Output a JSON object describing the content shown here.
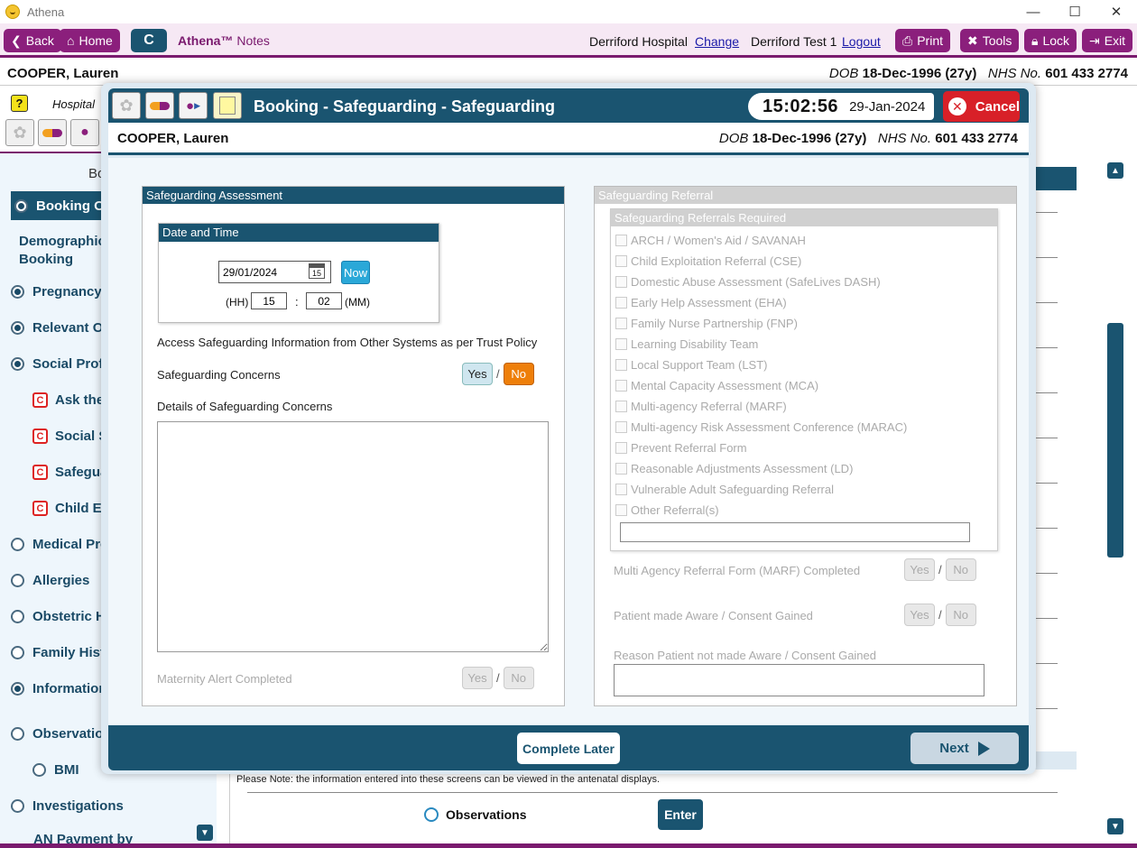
{
  "window": {
    "title": "Athena",
    "minimize": "—",
    "maximize": "☐",
    "close": "✕"
  },
  "toolbar": {
    "back_label": "Back",
    "home_label": "Home",
    "c_label": "C",
    "brand_name": "Athena™",
    "brand_suffix": "Notes",
    "hospital": "Derriford Hospital",
    "change_label": "Change",
    "user": "Derriford Test 1",
    "logout_label": "Logout",
    "print_label": "Print",
    "tools_label": "Tools",
    "lock_label": "Lock",
    "exit_label": "Exit",
    "accent": "#8b1f7c"
  },
  "patient": {
    "name": "COOPER, Lauren",
    "dob_label": "DOB",
    "dob": "18-Dec-1996 (27y)",
    "nhs_label": "NHS No.",
    "nhs": "601 433 2774"
  },
  "background": {
    "help_icon": "?",
    "hospital_label": "Hospital",
    "booking_title": "Bo",
    "nav_items": [
      {
        "label": "Booking Ov",
        "radio": "on",
        "active": true
      },
      {
        "label": "Demographics",
        "label2": "Booking"
      },
      {
        "label": "Pregnancy",
        "radio": "on"
      },
      {
        "label": "Relevant Ot",
        "radio": "on"
      },
      {
        "label": "Social Profil",
        "radio": "on"
      },
      {
        "label": "Ask the",
        "badge": "C"
      },
      {
        "label": "Social Se",
        "badge": "C"
      },
      {
        "label": "Safegua",
        "badge": "C"
      },
      {
        "label": "Child Exp",
        "badge": "C"
      },
      {
        "label": "Medical Pro",
        "radio": "off"
      },
      {
        "label": "Allergies",
        "radio": "off"
      },
      {
        "label": "Obstetric H",
        "radio": "off"
      },
      {
        "label": "Family Histo",
        "radio": "off"
      },
      {
        "label": "Information",
        "radio": "on"
      },
      {
        "label": "Observation",
        "radio": "off"
      },
      {
        "label": "BMI",
        "radio": "off"
      },
      {
        "label": "Investigations",
        "radio": "off"
      },
      {
        "label": "AN Payment by"
      }
    ],
    "note": "Please Note: the information entered into these screens can be viewed in the antenatal displays.",
    "observations_label": "Observations",
    "enter_label": "Enter"
  },
  "modal": {
    "title": "Booking - Safeguarding - Safeguarding",
    "time": "15:02:56",
    "date": "29-Jan-2024",
    "cancel_label": "Cancel",
    "assessment": {
      "header": "Safeguarding Assessment",
      "datetime_header": "Date and Time",
      "date_value": "29/01/2024",
      "calendar_day": "15",
      "now_label": "Now",
      "hh_label": "(HH)",
      "hh_value": "15",
      "colon": ":",
      "mm_value": "02",
      "mm_label": "(MM)",
      "access_text": "Access Safeguarding Information from Other Systems as per Trust Policy",
      "concerns_label": "Safeguarding Concerns",
      "yes": "Yes",
      "no": "No",
      "slash": "/",
      "details_label": "Details of Safeguarding Concerns",
      "alert_label": "Maternity Alert Completed"
    },
    "referral": {
      "header": "Safeguarding Referral",
      "required_header": "Safeguarding Referrals Required",
      "items": [
        "ARCH / Women's Aid / SAVANAH",
        "Child Exploitation Referral (CSE)",
        "Domestic Abuse Assessment (SafeLives DASH)",
        "Early Help Assessment (EHA)",
        "Family Nurse Partnership (FNP)",
        "Learning Disability Team",
        "Local Support Team (LST)",
        "Mental Capacity Assessment (MCA)",
        "Multi-agency Referral (MARF)",
        "Multi-agency Risk Assessment Conference (MARAC)",
        "Prevent Referral Form",
        "Reasonable Adjustments Assessment (LD)",
        "Vulnerable Adult Safeguarding Referral",
        "Other Referral(s)"
      ],
      "marf_label": "Multi Agency Referral Form (MARF) Completed",
      "aware_label": "Patient made Aware / Consent Gained",
      "reason_label": "Reason Patient not made Aware / Consent Gained"
    },
    "complete_later_label": "Complete Later",
    "next_label": "Next"
  }
}
